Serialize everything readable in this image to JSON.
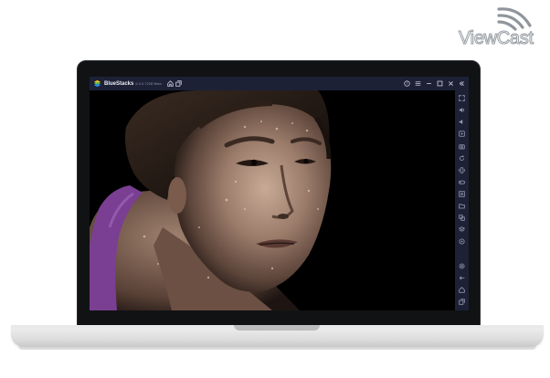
{
  "brand": {
    "name": "ViewCast",
    "wave_color": "#9aa0a6"
  },
  "window": {
    "app_name": "BlueStacks",
    "version": "5.0.0.7228 Beta",
    "titlebar_color": "#1d2136",
    "titlebar_left_icons": [
      "bluestacks-logo-icon",
      "home-icon",
      "multi-instance-icon"
    ],
    "titlebar_right_icons": [
      "help-icon",
      "menu-icon",
      "minimize-icon",
      "maximize-icon",
      "close-icon",
      "collapse-sidebar-icon"
    ]
  },
  "content": {
    "image": "photo of a sweating woman athlete in a purple sports top, close-up on dark background",
    "background": "#000000"
  },
  "sidebar": {
    "icons": [
      "fullscreen-icon",
      "volume-up-icon",
      "volume-down-icon",
      "screen-record-icon",
      "screenshot-icon",
      "rotate-icon",
      "shake-icon",
      "gamepad-icon",
      "macro-icon",
      "folder-icon",
      "multi-instance-sync-icon",
      "eco-mode-icon",
      "location-icon",
      "settings-icon",
      "back-icon",
      "home-nav-icon",
      "recent-apps-icon"
    ]
  }
}
